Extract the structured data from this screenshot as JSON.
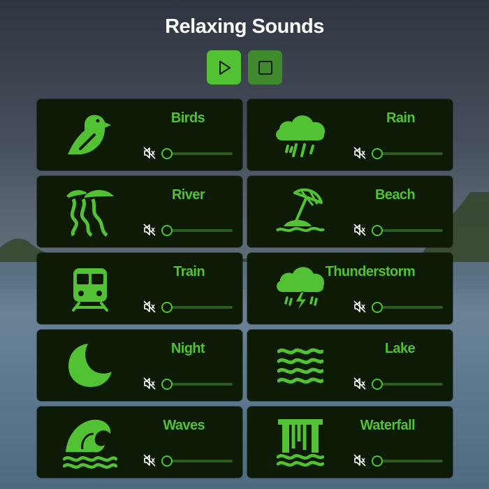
{
  "header": {
    "title": "Relaxing Sounds"
  },
  "controls": {
    "play_icon": "play-icon",
    "stop_icon": "stop-icon"
  },
  "colors": {
    "accent": "#52c234",
    "accent_dark": "#3f8a2c",
    "card_bg": "#0d1a05"
  },
  "sounds": [
    {
      "label": "Birds",
      "icon": "bird-icon",
      "volume": 0,
      "muted": true
    },
    {
      "label": "Rain",
      "icon": "rain-cloud-icon",
      "volume": 0,
      "muted": true
    },
    {
      "label": "River",
      "icon": "river-icon",
      "volume": 0,
      "muted": true
    },
    {
      "label": "Beach",
      "icon": "beach-umbrella-icon",
      "volume": 0,
      "muted": true
    },
    {
      "label": "Train",
      "icon": "train-icon",
      "volume": 0,
      "muted": true
    },
    {
      "label": "Thunderstorm",
      "icon": "thunderstorm-icon",
      "volume": 0,
      "muted": true
    },
    {
      "label": "Night",
      "icon": "moon-icon",
      "volume": 0,
      "muted": true
    },
    {
      "label": "Lake",
      "icon": "lake-waves-icon",
      "volume": 0,
      "muted": true
    },
    {
      "label": "Waves",
      "icon": "ocean-wave-icon",
      "volume": 0,
      "muted": true
    },
    {
      "label": "Waterfall",
      "icon": "waterfall-icon",
      "volume": 0,
      "muted": true
    }
  ]
}
